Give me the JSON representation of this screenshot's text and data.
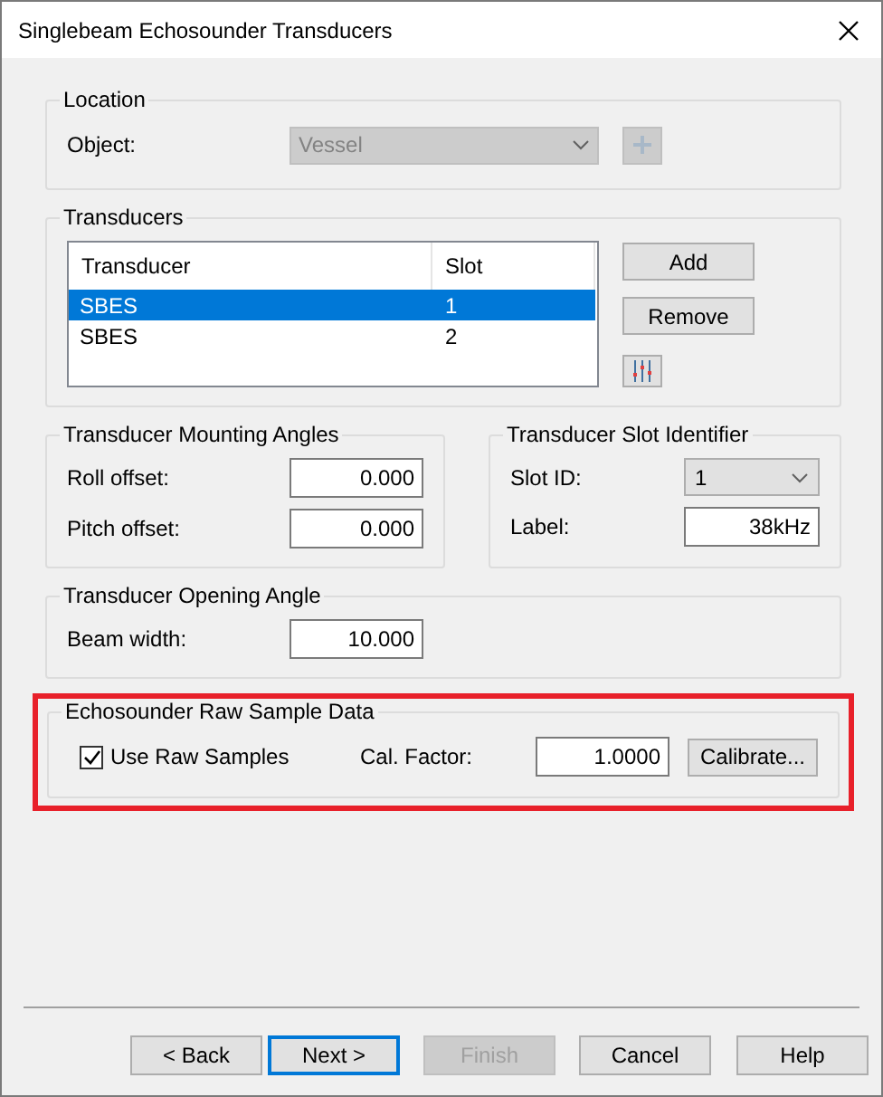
{
  "window": {
    "title": "Singlebeam Echosounder Transducers"
  },
  "location": {
    "title": "Location",
    "object_label": "Object:",
    "object_value": "Vessel",
    "object_disabled": true,
    "add_disabled": true
  },
  "transducers": {
    "title": "Transducers",
    "columns": [
      "Transducer",
      "Slot"
    ],
    "rows": [
      {
        "cells": [
          "SBES",
          "1"
        ],
        "selected": true
      },
      {
        "cells": [
          "SBES",
          "2"
        ],
        "selected": false
      }
    ],
    "buttons": [
      "Add",
      "Remove"
    ]
  },
  "mounting": {
    "title": "Transducer Mounting Angles",
    "fields": [
      {
        "label": "Roll offset:",
        "value": "0.000"
      },
      {
        "label": "Pitch offset:",
        "value": "0.000"
      }
    ]
  },
  "slot_identifier": {
    "title": "Transducer Slot Identifier",
    "slot_label": "Slot ID:",
    "slot_value": "1",
    "label_label": "Label:",
    "label_value": "38kHz"
  },
  "opening": {
    "title": "Transducer Opening Angle",
    "field": {
      "label": "Beam width:",
      "value": "10.000"
    }
  },
  "raw": {
    "title": "Echosounder Raw Sample Data",
    "highlighted": true,
    "checkbox": {
      "label": "Use Raw Samples",
      "checked": true
    },
    "factor_label": "Cal. Factor:",
    "factor_value": "1.0000",
    "button": "Calibrate..."
  },
  "footer": {
    "buttons": [
      {
        "label": "< Back",
        "default": false,
        "disabled": false
      },
      {
        "label": "Next >",
        "default": true,
        "disabled": false
      },
      {
        "label": "Finish",
        "default": false,
        "disabled": true
      },
      {
        "label": "Cancel",
        "default": false,
        "disabled": false
      },
      {
        "label": "Help",
        "default": false,
        "disabled": false
      }
    ]
  }
}
